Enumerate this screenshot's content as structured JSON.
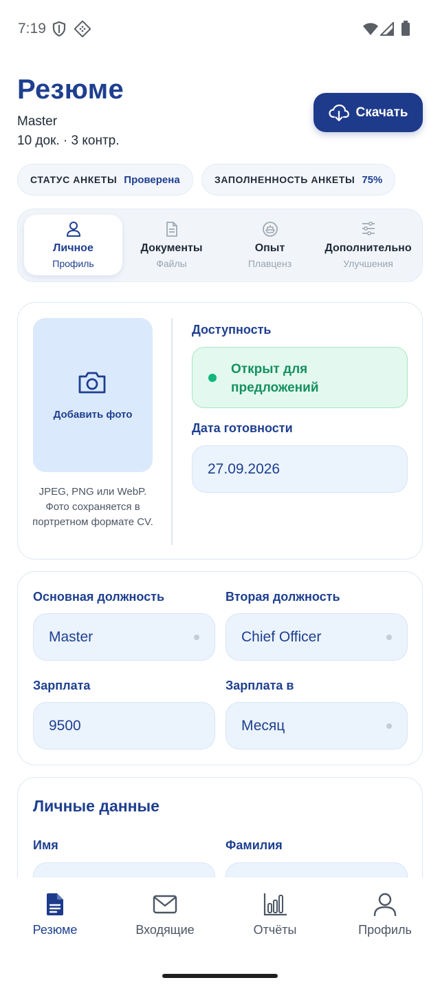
{
  "status_bar": {
    "time": "7:19",
    "icons": [
      "shield-icon",
      "nav-icon",
      "wifi-icon",
      "signal-icon",
      "battery-icon"
    ]
  },
  "header": {
    "title": "Резюме",
    "position": "Master",
    "meta": "10 док. · 3 контр.",
    "download_label": "Скачать"
  },
  "chips": [
    {
      "key": "СТАТУС АНКЕТЫ",
      "value": "Проверена"
    },
    {
      "key": "ЗАПОЛНЕННОСТЬ АНКЕТЫ",
      "value": "75%"
    }
  ],
  "tabs": [
    {
      "label": "Личное",
      "sub": "Профиль",
      "icon": "user-icon",
      "active": true
    },
    {
      "label": "Документы",
      "sub": "Файлы",
      "icon": "document-icon",
      "active": false
    },
    {
      "label": "Опыт",
      "sub": "Плавценз",
      "icon": "ship-icon",
      "active": false
    },
    {
      "label": "Дополнительно",
      "sub": "Улучшения",
      "icon": "sliders-icon",
      "active": false
    }
  ],
  "photo": {
    "add_label": "Добавить фото",
    "hint": "JPEG, PNG или WebP. Фото сохраняется в портретном формате CV."
  },
  "availability": {
    "label": "Доступность",
    "status": "Открыт для предложений",
    "date_label": "Дата готовности",
    "date_value": "27.09.2026"
  },
  "job": {
    "primary_label": "Основная должность",
    "primary_value": "Master",
    "secondary_label": "Вторая должность",
    "secondary_value": "Chief Officer",
    "salary_label": "Зарплата",
    "salary_value": "9500",
    "salary_period_label": "Зарплата в",
    "salary_period_value": "Месяц"
  },
  "personal": {
    "title": "Личные данные",
    "first_name_label": "Имя",
    "last_name_label": "Фамилия"
  },
  "bottom_nav": [
    {
      "label": "Резюме",
      "icon": "resume-icon",
      "active": true
    },
    {
      "label": "Входящие",
      "icon": "mail-icon",
      "active": false
    },
    {
      "label": "Отчёты",
      "icon": "chart-icon",
      "active": false
    },
    {
      "label": "Профиль",
      "icon": "profile-icon",
      "active": false
    }
  ],
  "colors": {
    "primary": "#1e3a8a",
    "success": "#10b77f",
    "field_bg": "#ebf3fd"
  }
}
